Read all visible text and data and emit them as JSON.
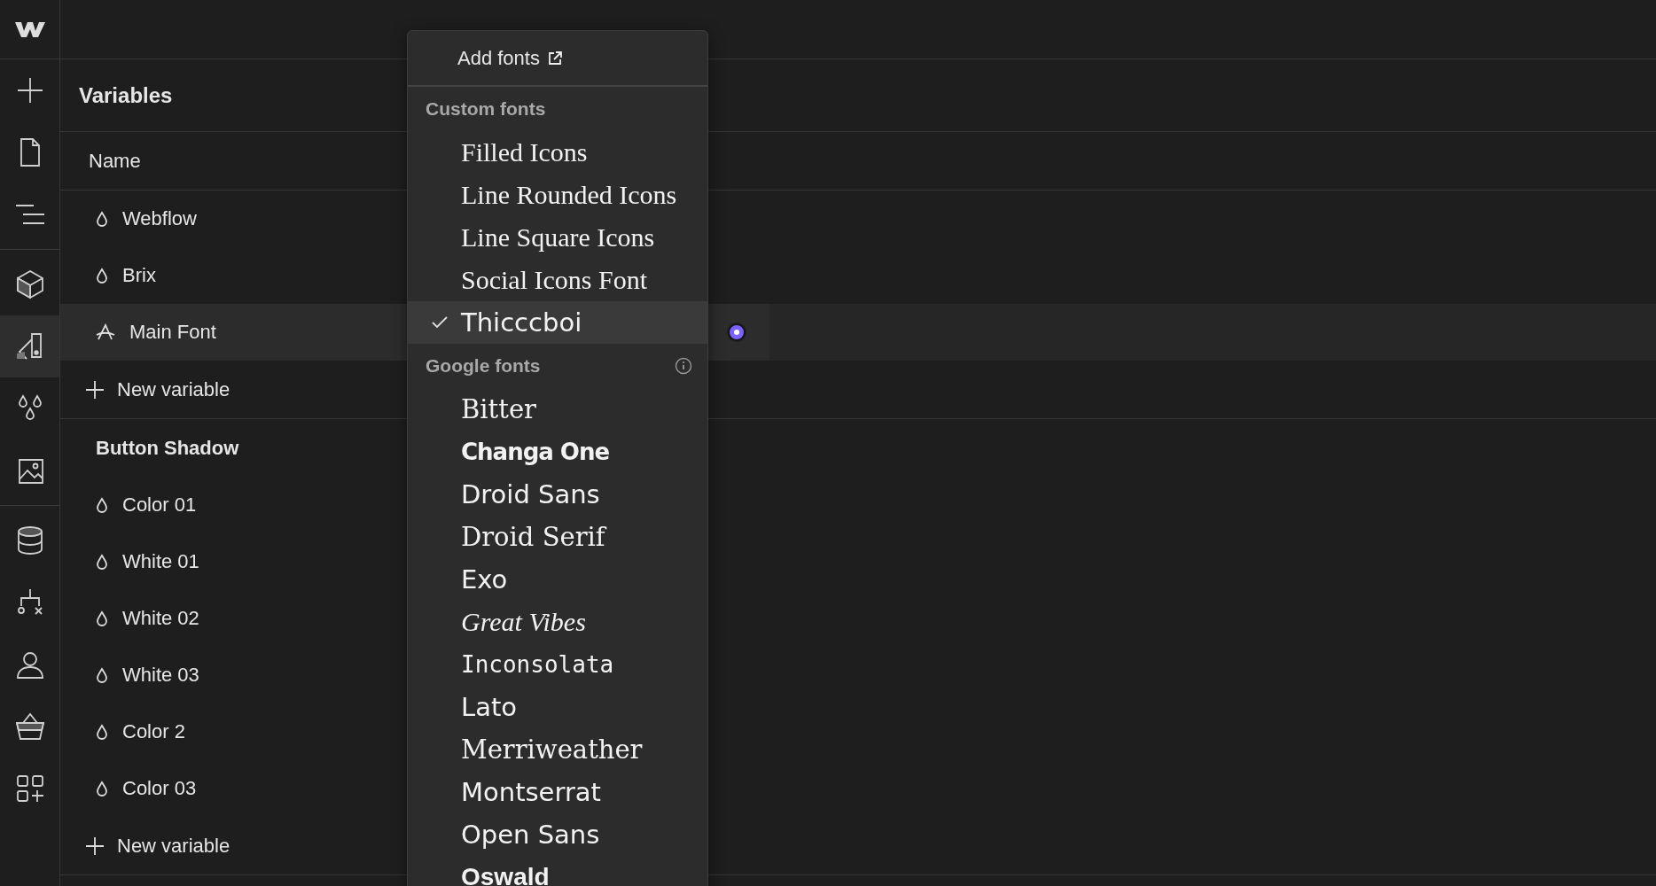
{
  "rail": [
    {
      "kind": "plus",
      "selected": false
    },
    {
      "kind": "page",
      "selected": false
    },
    {
      "kind": "navigator",
      "selected": false
    },
    {
      "kind": "divider"
    },
    {
      "kind": "cube",
      "selected": false
    },
    {
      "kind": "style",
      "selected": true
    },
    {
      "kind": "drops",
      "selected": false
    },
    {
      "kind": "image",
      "selected": false
    },
    {
      "kind": "divider"
    },
    {
      "kind": "database",
      "selected": false
    },
    {
      "kind": "logic",
      "selected": false
    },
    {
      "kind": "user",
      "selected": false
    },
    {
      "kind": "basket",
      "selected": false
    },
    {
      "kind": "apps",
      "selected": false
    }
  ],
  "panel": {
    "title": "Variables",
    "column": "Name"
  },
  "groups": [
    {
      "variables": [
        {
          "name": "Webflow",
          "kind": "color",
          "selected": false
        },
        {
          "name": "Brix",
          "kind": "color",
          "selected": false
        },
        {
          "name": "Main Font",
          "kind": "font",
          "selected": true
        }
      ],
      "new_label": "New variable"
    },
    {
      "title": "Button Shadow",
      "variables": [
        {
          "name": "Color 01",
          "kind": "color",
          "selected": false
        },
        {
          "name": "White 01",
          "kind": "color",
          "selected": false
        },
        {
          "name": "White 02",
          "kind": "color",
          "selected": false
        },
        {
          "name": "White 03",
          "kind": "color",
          "selected": false
        },
        {
          "name": "Color 2",
          "kind": "color",
          "selected": false
        },
        {
          "name": "Color 03",
          "kind": "color",
          "selected": false
        }
      ],
      "new_label": "New variable"
    }
  ],
  "dropdown": {
    "add_label": "Add fonts",
    "sections": [
      {
        "title": "Custom fonts",
        "info": false,
        "fonts": [
          {
            "name": "Filled Icons",
            "kind": "serif",
            "selected": false
          },
          {
            "name": "Line Rounded Icons",
            "kind": "serif",
            "selected": false
          },
          {
            "name": "Line Square Icons",
            "kind": "serif",
            "selected": false
          },
          {
            "name": "Social Icons Font",
            "kind": "serif",
            "selected": false
          },
          {
            "name": "Thicccboi",
            "kind": "sans",
            "selected": true
          }
        ]
      },
      {
        "title": "Google fonts",
        "info": true,
        "fonts": [
          {
            "name": "Bitter",
            "kind": "slab",
            "selected": false
          },
          {
            "name": "Changa One",
            "kind": "heavy",
            "selected": false
          },
          {
            "name": "Droid Sans",
            "kind": "sans",
            "selected": false
          },
          {
            "name": "Droid Serif",
            "kind": "slab",
            "selected": false
          },
          {
            "name": "Exo",
            "kind": "sans",
            "selected": false
          },
          {
            "name": "Great Vibes",
            "kind": "script",
            "selected": false
          },
          {
            "name": "Inconsolata",
            "kind": "mono",
            "selected": false
          },
          {
            "name": "Lato",
            "kind": "sans",
            "selected": false
          },
          {
            "name": "Merriweather",
            "kind": "slab",
            "selected": false
          },
          {
            "name": "Montserrat",
            "kind": "sans",
            "selected": false
          },
          {
            "name": "Open Sans",
            "kind": "sans",
            "selected": false
          },
          {
            "name": "Oswald",
            "kind": "condensed",
            "selected": false
          }
        ]
      }
    ]
  },
  "value_dot": {
    "color": "#7b61ff"
  }
}
